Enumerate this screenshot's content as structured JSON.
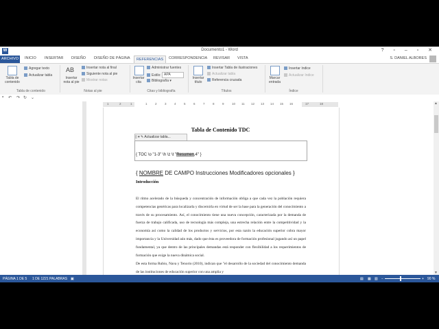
{
  "app": {
    "doc_title": "Documento1 - Word",
    "window_controls": "? ▫ – ▫ ✕",
    "user": "S. DANIEL ALBORES"
  },
  "tabs": [
    "ARCHIVO",
    "INICIO",
    "INSERTAR",
    "DISEÑO",
    "DISEÑO DE PÁGINA",
    "REFERENCIAS",
    "CORRESPONDENCIA",
    "REVISAR",
    "VISTA"
  ],
  "ribbon": {
    "toc_group": {
      "toc_button": "Tabla de contenido",
      "add_text": "Agregar texto",
      "update_table": "Actualizar tabla",
      "label": "Tabla de contenido"
    },
    "footnotes_group": {
      "insert_footnote": "Insertar nota al pie",
      "insert_endnote": "Insertar nota al final",
      "next_footnote": "Siguiente nota al pie",
      "show_notes": "Mostrar notas",
      "label": "Notas al pie",
      "ab_glyph": "AB"
    },
    "citations_group": {
      "insert_citation": "Insertar cita",
      "manage_sources": "Administrar fuentes",
      "style_label": "Estilo:",
      "style_value": "APA",
      "bibliography": "Bibliografía",
      "label": "Citas y bibliografía"
    },
    "captions_group": {
      "insert_caption": "Insertar título",
      "insert_table_of_figures": "Insertar Tabla de ilustraciones",
      "update_table": "Actualizar tabla",
      "cross_reference": "Referencia cruzada",
      "label": "Títulos"
    },
    "index_group": {
      "mark_entry": "Marcar entrada",
      "insert_index": "Insertar índice",
      "update_index": "Actualizar índice",
      "label": "Índice"
    }
  },
  "ruler_numbers": [
    "1",
    "2",
    "1",
    "1",
    "2",
    "3",
    "4",
    "5",
    "6",
    "7",
    "8",
    "9",
    "10",
    "11",
    "12",
    "13",
    "14",
    "15",
    "16",
    "17",
    "18"
  ],
  "document": {
    "toc_heading": "Tabla de Contenido TDC",
    "cc_update": "Actualizar tabla...",
    "field_code_before": "{ TOC \\o \"1-3\" \\h \\z \\t \"",
    "field_code_hl": "Resumen",
    "field_code_after": ",4\" }",
    "syntax_open": "{ ",
    "syntax_name": "NOMBRE",
    "syntax_rest": " DE CAMPO Instrucciones Modificadores opcionales }",
    "intro_heading": "Introducción",
    "paragraph1": "El ritmo acelerado de la búsqueda y concentración de información obliga a que cada vez la población requiera competencias genéricas para localizarla y discernirla en virtud de ser la base para la generación del conocimiento a través de su procesamiento. Así, el conocimiento tiene una nueva concepción, caracterizada por la demanda de fuerza de trabajo calificada, uso de tecnología más compleja, una estrecha relación entre la competitividad y la economía así como la calidad de los productos y servicios, por esta razón la educación superior cobra mayor importancia y la Universidad aún más, dado que ésta es proveedora de formación profesional jugando así un papel fundamental, ya que dentro de las principales demandas está responder con flexibilidad a los requerimientos de formación que exige la nueva dinámica social.",
    "paragraph2": "De esta forma Rubio, Nava y Tenorio (2010), indican que \"el desarrollo de la sociedad del conocimiento demanda de las instituciones de educación superior con una amplia y"
  },
  "status": {
    "page": "PÁGINA 1 DE 5",
    "words": "1 DE 1221 PALABRAS",
    "zoom": "90 %"
  }
}
